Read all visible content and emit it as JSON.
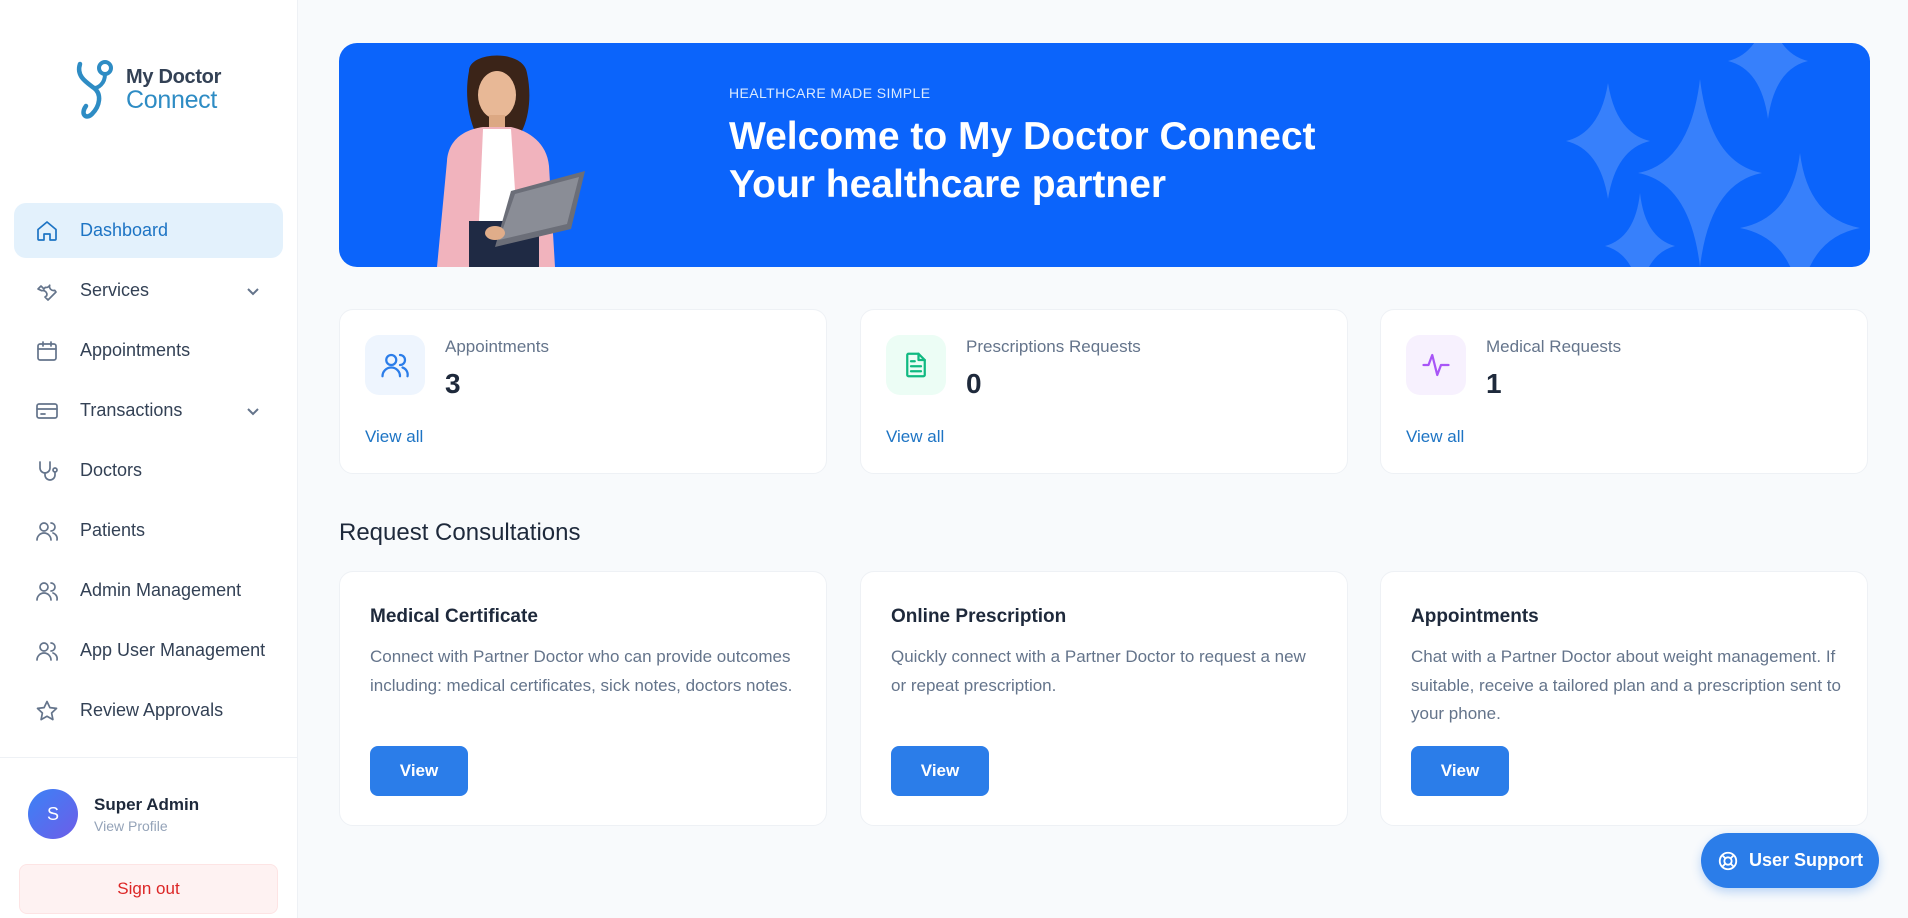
{
  "brand": {
    "line1": "My Doctor",
    "line2": "Connect"
  },
  "sidebar": {
    "items": [
      {
        "label": "Dashboard",
        "icon": "home-icon",
        "active": true
      },
      {
        "label": "Services",
        "icon": "wrench-icon",
        "dropdown": true
      },
      {
        "label": "Appointments",
        "icon": "calendar-icon"
      },
      {
        "label": "Transactions",
        "icon": "credit-card-icon",
        "dropdown": true
      },
      {
        "label": "Doctors",
        "icon": "stethoscope-icon"
      },
      {
        "label": "Patients",
        "icon": "users-icon"
      },
      {
        "label": "Admin Management",
        "icon": "users-icon"
      },
      {
        "label": "App User Management",
        "icon": "users-icon"
      },
      {
        "label": "Review Approvals",
        "icon": "star-icon"
      }
    ]
  },
  "profile": {
    "initial": "S",
    "name": "Super Admin",
    "link": "View Profile"
  },
  "signout_label": "Sign out",
  "hero": {
    "kicker": "HEALTHCARE MADE SIMPLE",
    "title_line1": "Welcome to My Doctor Connect",
    "title_line2": "Your healthcare partner"
  },
  "stats": [
    {
      "label": "Appointments",
      "value": "3",
      "link": "View all",
      "icon": "users-icon",
      "color": "#2b7de9",
      "bg": "#eef5fe"
    },
    {
      "label": "Prescriptions Requests",
      "value": "0",
      "link": "View all",
      "icon": "document-icon",
      "color": "#10b981",
      "bg": "#ecfdf5"
    },
    {
      "label": "Medical Requests",
      "value": "1",
      "link": "View all",
      "icon": "activity-icon",
      "color": "#a855f7",
      "bg": "#f7f1fe"
    }
  ],
  "consultations": {
    "section_title": "Request Consultations",
    "cards": [
      {
        "title": "Medical Certificate",
        "desc": "Connect with Partner Doctor who can provide outcomes including: medical certificates, sick notes, doctors notes.",
        "button": "View"
      },
      {
        "title": "Online Prescription",
        "desc": "Quickly connect with a Partner Doctor to request a new or repeat prescription.",
        "button": "View"
      },
      {
        "title": "Appointments",
        "desc": "Chat with a Partner Doctor about weight management. If suitable, receive a tailored plan and a prescription sent to your phone.",
        "button": "View"
      }
    ]
  },
  "support_label": "User Support",
  "colors": {
    "accent": "#2b7de9",
    "hero_bg": "#0b64fb",
    "danger": "#dc2626"
  }
}
